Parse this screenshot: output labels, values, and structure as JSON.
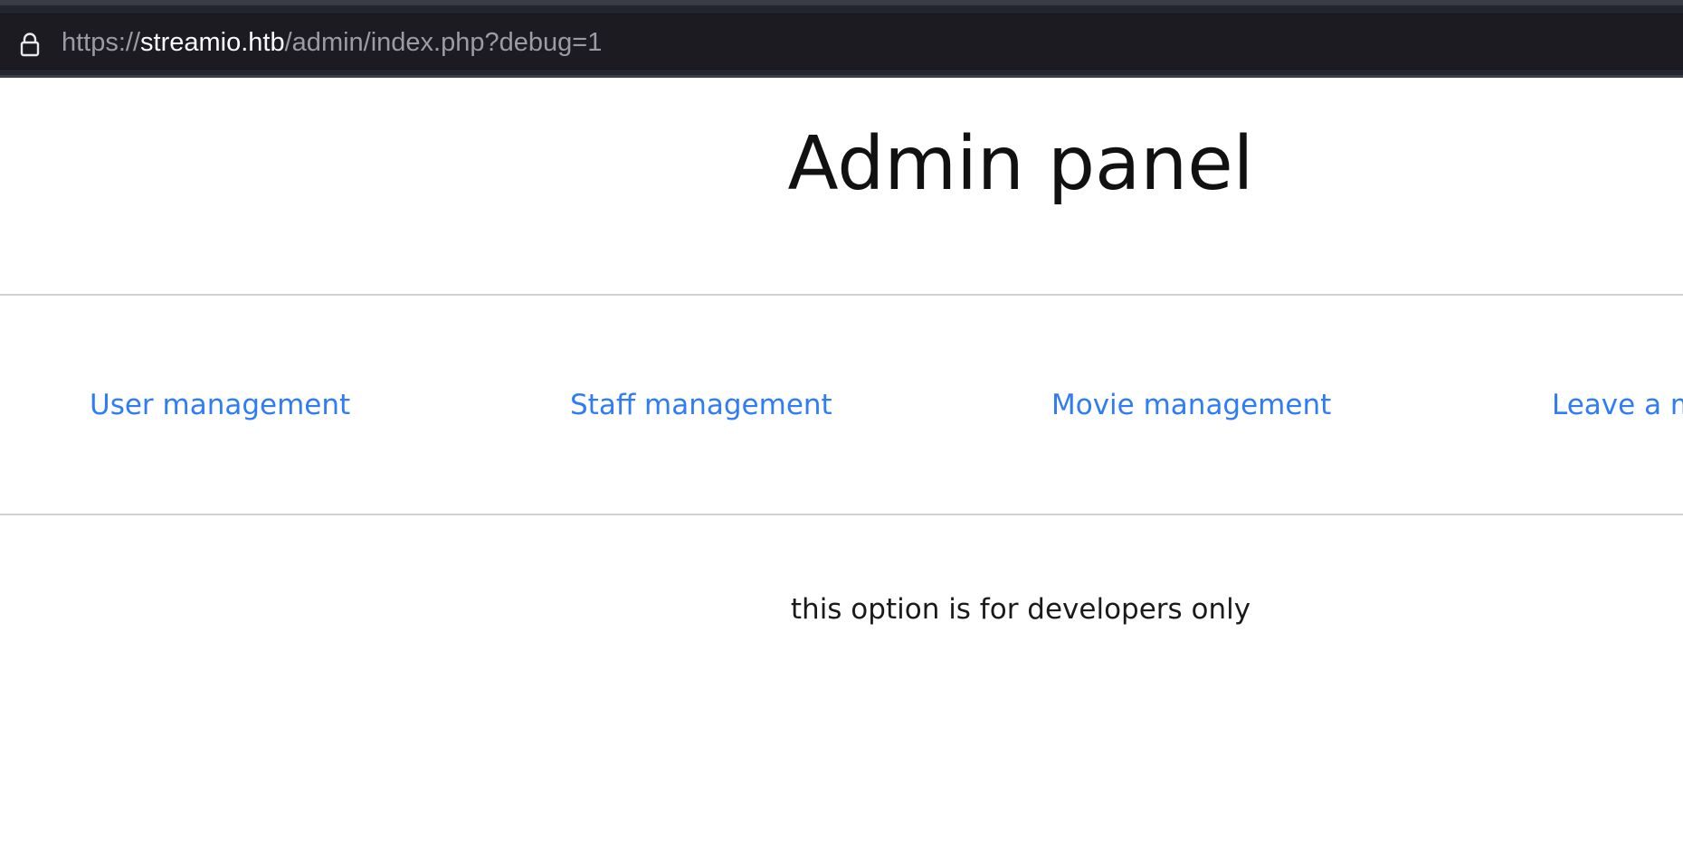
{
  "browser": {
    "url": {
      "scheme": "https://",
      "host": "streamio.htb",
      "path": "/admin/index.php?debug=1"
    },
    "icons": {
      "lock": "lock-icon"
    }
  },
  "page": {
    "title": "Admin panel",
    "nav": [
      {
        "label": "User management"
      },
      {
        "label": "Staff management"
      },
      {
        "label": "Movie management"
      },
      {
        "label": "Leave a m"
      }
    ],
    "notice": "this option is for developers only"
  },
  "colors": {
    "link": "#2f7cf6",
    "toolbar_bg": "#23252e",
    "urlbar_bg": "#1c1b22",
    "divider": "#d2d2d2"
  }
}
